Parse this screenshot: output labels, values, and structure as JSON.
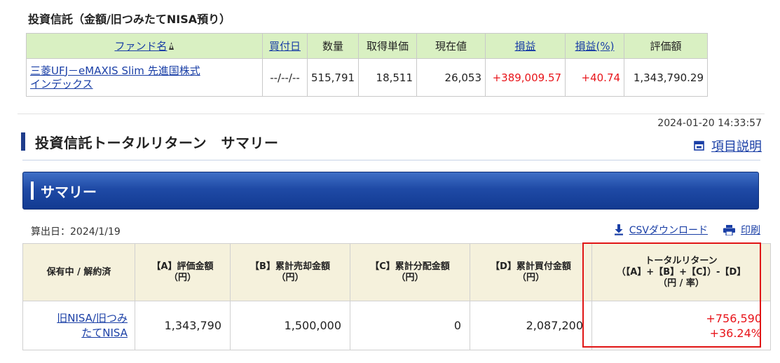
{
  "holdings_section": {
    "title": "投資信託（金額/旧つみたてNISA預り）",
    "columns": {
      "fund_name": "ファンド名",
      "buy_date": "買付日",
      "quantity": "数量",
      "unit_cost": "取得単価",
      "current_price": "現在値",
      "profit": "損益",
      "profit_pct": "損益(%)",
      "valuation": "評価額"
    },
    "rows": [
      {
        "fund_name_line1": "三菱UFJ－eMAXIS Slim 先進国株式",
        "fund_name_line2": "インデックス",
        "buy_date": "--/--/--",
        "quantity": "515,791",
        "unit_cost": "18,511",
        "current_price": "26,053",
        "profit": "+389,009.57",
        "profit_pct": "+40.74",
        "valuation": "1,343,790.29"
      }
    ]
  },
  "timestamp": "2024-01-20 14:33:57",
  "total_return": {
    "title": "投資信託トータルリターン　サマリー",
    "help_label": "項目説明"
  },
  "summary": {
    "banner_title": "サマリー",
    "calc_date": "算出日：2024/1/19",
    "csv_label": "CSVダウンロード",
    "print_label": "印刷",
    "headers": {
      "account": "保有中 / 解約済",
      "a_line1": "【A】評価金額",
      "a_line2": "（円）",
      "b_line1": "【B】累計売却金額",
      "b_line2": "（円）",
      "c_line1": "【C】累計分配金額",
      "c_line2": "（円）",
      "d_line1": "【D】累計買付金額",
      "d_line2": "（円）",
      "tr_line1": "トータルリターン",
      "tr_line2": "（【A】+【B】+【C】）-【D】",
      "tr_line3": "（円 / 率）"
    },
    "row": {
      "account_line1": "旧NISA/旧つみ",
      "account_line2": "たてNISA",
      "a": "1,343,790",
      "b": "1,500,000",
      "c": "0",
      "d": "2,087,200",
      "tr_amount": "+756,590",
      "tr_rate": "+36.24%"
    }
  },
  "icons": {
    "sort": "sort-arrow-icon",
    "help": "window-icon",
    "csv": "download-icon",
    "print": "printer-icon"
  },
  "colors": {
    "positive": "#e8141a",
    "header_green": "#d9f0c2",
    "header_beige": "#f5f1dc",
    "banner_blue": "#1f4aa6",
    "link": "#1a3fa6",
    "highlight": "#e01515"
  }
}
